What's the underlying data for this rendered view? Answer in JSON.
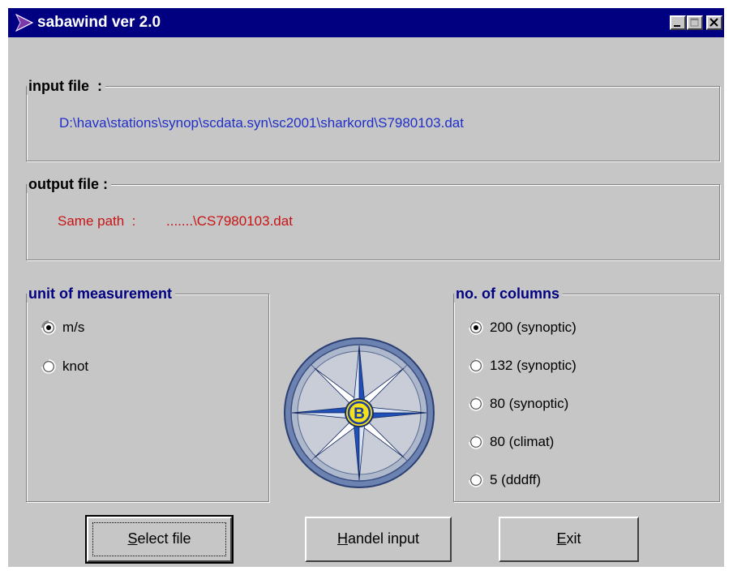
{
  "window": {
    "title": "sabawind ver 2.0"
  },
  "input_group": {
    "legend": "input file  :",
    "path": "D:\\hava\\stations\\synop\\scdata.syn\\sc2001\\sharkord\\S7980103.dat"
  },
  "output_group": {
    "legend": "output file :",
    "path_label": "Same path  :",
    "path_value": ".......\\CS7980103.dat"
  },
  "unit_group": {
    "legend": "unit of measurement",
    "options": [
      {
        "label": "m/s",
        "selected": true
      },
      {
        "label": "knot",
        "selected": false
      }
    ]
  },
  "columns_group": {
    "legend": "no. of columns",
    "options": [
      {
        "label": "200 (synoptic)",
        "selected": true
      },
      {
        "label": "132 (synoptic)",
        "selected": false
      },
      {
        "label": "80 (synoptic)",
        "selected": false
      },
      {
        "label": "80 (climat)",
        "selected": false
      },
      {
        "label": "5 (dddff)",
        "selected": false
      }
    ]
  },
  "compass": {
    "center_letter": "B"
  },
  "buttons": {
    "select_file": {
      "mnemonic": "S",
      "rest": "elect file"
    },
    "handel_input": {
      "mnemonic": "H",
      "rest": "andel input"
    },
    "exit": {
      "mnemonic": "E",
      "rest": "xit"
    }
  },
  "colors": {
    "titlebar": "#000080",
    "window_bg": "#c6c6c6",
    "input_path": "#1f2fc8",
    "output_path": "#c81414",
    "legend_blue": "#000080"
  }
}
